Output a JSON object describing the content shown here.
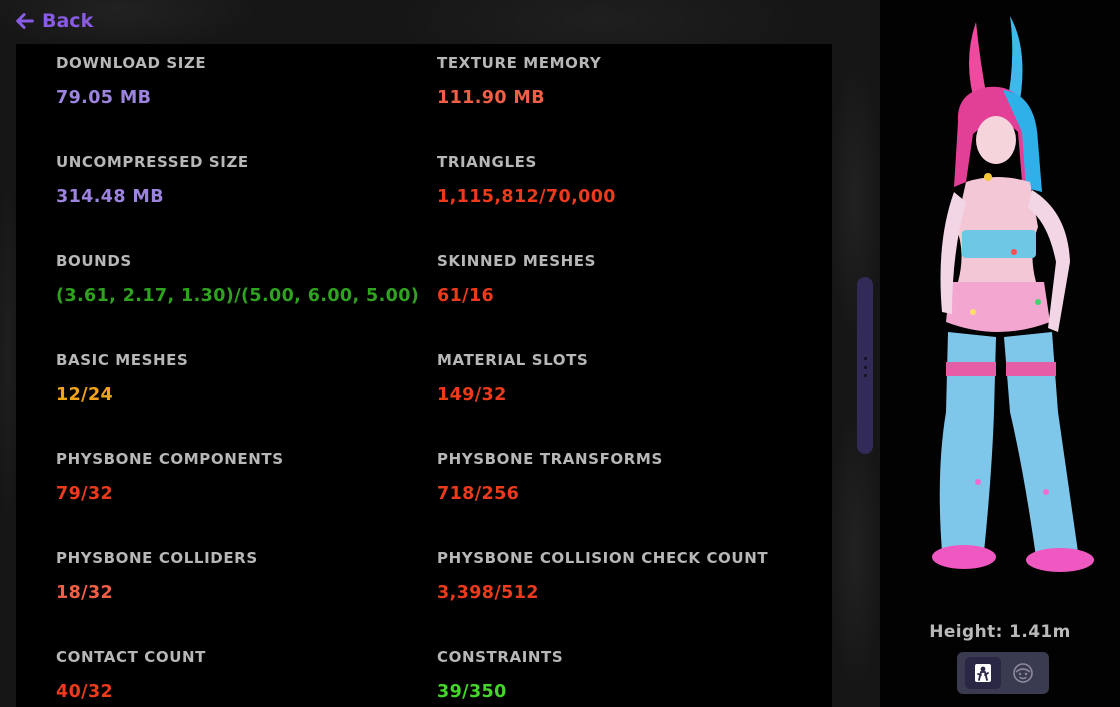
{
  "back": {
    "label": "Back"
  },
  "stats": [
    {
      "label": "DOWNLOAD SIZE",
      "value": "79.05 MB",
      "color": "#9c84de"
    },
    {
      "label": "TEXTURE MEMORY",
      "value": "111.90 MB",
      "color": "#f25f46"
    },
    {
      "label": "UNCOMPRESSED SIZE",
      "value": "314.48 MB",
      "color": "#9c84de"
    },
    {
      "label": "TRIANGLES",
      "value": "1,115,812/70,000",
      "color": "#ec3a1c"
    },
    {
      "label": "BOUNDS",
      "value": "(3.61, 2.17, 1.30)/(5.00, 6.00, 5.00)",
      "color": "#2fa21f"
    },
    {
      "label": "SKINNED MESHES",
      "value": "61/16",
      "color": "#ec3a1c"
    },
    {
      "label": "BASIC MESHES",
      "value": "12/24",
      "color": "#f2a31a"
    },
    {
      "label": "MATERIAL SLOTS",
      "value": "149/32",
      "color": "#ec3a1c"
    },
    {
      "label": "PHYSBONE COMPONENTS",
      "value": "79/32",
      "color": "#ec3a1c"
    },
    {
      "label": "PHYSBONE TRANSFORMS",
      "value": "718/256",
      "color": "#ec3a1c"
    },
    {
      "label": "PHYSBONE COLLIDERS",
      "value": "18/32",
      "color": "#f25f46"
    },
    {
      "label": "PHYSBONE COLLISION CHECK COUNT",
      "value": "3,398/512",
      "color": "#ec3a1c"
    },
    {
      "label": "CONTACT COUNT",
      "value": "40/32",
      "color": "#ec3a1c"
    },
    {
      "label": "CONSTRAINTS",
      "value": "39/350",
      "color": "#44d52b"
    }
  ],
  "avatar": {
    "height_label": "Height: 1.41m"
  },
  "view_toggle": {
    "selected": "full-body",
    "options": [
      {
        "icon": "full-body-view-icon"
      },
      {
        "icon": "face-view-icon"
      }
    ]
  },
  "colors": {
    "accent": "#8a5ce6",
    "scrollbar": "#322a58",
    "toggle_bg": "#3a3a50"
  }
}
